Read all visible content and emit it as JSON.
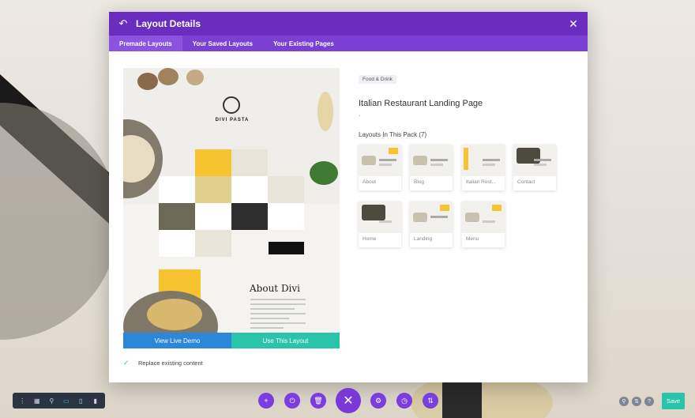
{
  "modal": {
    "title": "Layout Details",
    "tabs": [
      {
        "label": "Premade Layouts"
      },
      {
        "label": "Your Saved Layouts"
      },
      {
        "label": "Your Existing Pages"
      }
    ],
    "preview": {
      "brand": "DIVI PASTA",
      "about_heading": "About Divi",
      "live_demo_button": "View Live Demo",
      "use_layout_button": "Use This Layout",
      "replace_label": "Replace existing content"
    },
    "details": {
      "category_tag": "Food & Drink",
      "layout_title": "Italian Restaurant Landing Page",
      "dot": ".",
      "pack_heading": "Layouts In This Pack (7)",
      "layouts": [
        {
          "label": "About"
        },
        {
          "label": "Blog"
        },
        {
          "label": "Italian Rest..."
        },
        {
          "label": "Contact"
        },
        {
          "label": "Home"
        },
        {
          "label": "Landing"
        },
        {
          "label": "Menu"
        }
      ]
    }
  },
  "toolbar": {
    "save_label": "Save"
  },
  "icons": {
    "back": "back-arrow-icon",
    "close": "close-icon",
    "check": "check-icon",
    "left_tools": [
      "dots-icon",
      "wireframe-icon",
      "zoom-icon",
      "desktop-icon",
      "tablet-icon",
      "phone-icon"
    ],
    "center_tools": [
      "add-icon",
      "power-icon",
      "trash-icon",
      "close-icon",
      "gear-icon",
      "history-icon",
      "sort-icon"
    ],
    "right_tools": [
      "search-icon",
      "portability-icon",
      "help-icon"
    ]
  },
  "colors": {
    "header": "#6b2dc0",
    "tabs": "#7b3fd4",
    "demo_button": "#2b87da",
    "use_button": "#29c4a9",
    "save_button": "#29c4a9",
    "center_tools": "#7a3ee0"
  }
}
